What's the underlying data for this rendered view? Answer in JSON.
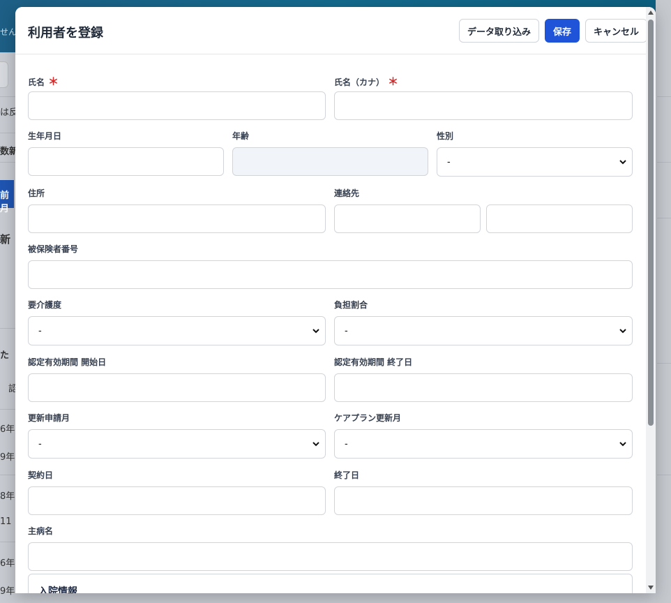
{
  "background": {
    "header_fragment": "せん",
    "fragments": [
      "は反",
      "数新",
      "前月",
      "新",
      "た",
      "認",
      "6年",
      "9年",
      "8年",
      "11",
      "6年",
      "9年"
    ],
    "button_fragment": "前月"
  },
  "modal": {
    "title": "利用者を登録",
    "buttons": {
      "import": "データ取り込み",
      "save": "保存",
      "cancel": "キャンセル"
    },
    "required_mark": "＊",
    "fields": {
      "name": "氏名",
      "name_kana": "氏名（カナ）",
      "birthdate": "生年月日",
      "age": "年齢",
      "gender": "性別",
      "gender_value": "-",
      "address": "住所",
      "contact": "連絡先",
      "insured_number": "被保険者番号",
      "care_level": "要介護度",
      "care_level_value": "-",
      "burden_ratio": "負担割合",
      "burden_ratio_value": "-",
      "cert_start": "認定有効期間 開始日",
      "cert_end": "認定有効期間 終了日",
      "renewal_month": "更新申請月",
      "renewal_month_value": "-",
      "careplan_month": "ケアプラン更新月",
      "careplan_month_value": "-",
      "contract_date": "契約日",
      "end_date": "終了日",
      "main_disease": "主病名"
    },
    "section_title": "入院情報"
  }
}
